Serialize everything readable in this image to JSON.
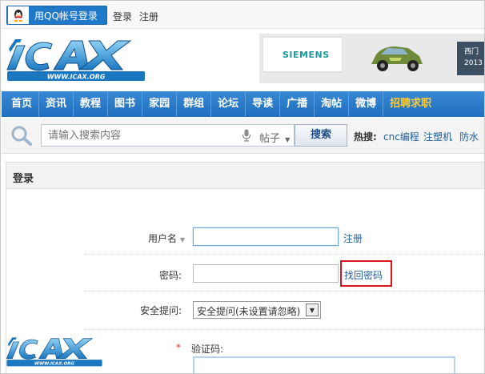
{
  "topbar": {
    "qq_login": "用QQ帐号登录",
    "login": "登录",
    "register": "注册"
  },
  "logo": {
    "text": "ICAX",
    "url_text": "WWW.ICAX.ORG"
  },
  "banner": {
    "brand": "SIEMENS",
    "dark_text_1": "西门",
    "dark_text_2": "2013"
  },
  "nav": {
    "items": [
      "首页",
      "资讯",
      "教程",
      "图书",
      "家园",
      "群组",
      "论坛",
      "导读",
      "广播",
      "淘帖",
      "微博",
      "招聘求职"
    ]
  },
  "search": {
    "placeholder": "请输入搜索内容",
    "type": "帖子",
    "button": "搜索",
    "hot_label": "热搜:",
    "hot": [
      "cnc编程",
      "注塑机",
      "防水"
    ]
  },
  "login_panel": {
    "title": "登录",
    "username_label": "用户名",
    "username_value": "",
    "register_link": "注册",
    "password_label": "密码:",
    "password_value": "",
    "forgot_link": "找回密码",
    "question_label": "安全提问:",
    "question_selected": "安全提问(未设置请忽略)",
    "captcha_label": "验证码:",
    "required_mark": "*"
  },
  "colors": {
    "nav_blue": "#1e6fbe",
    "link_blue": "#1f5f9f",
    "highlight_red": "#d9161c",
    "special_nav": "#ffcc33"
  }
}
